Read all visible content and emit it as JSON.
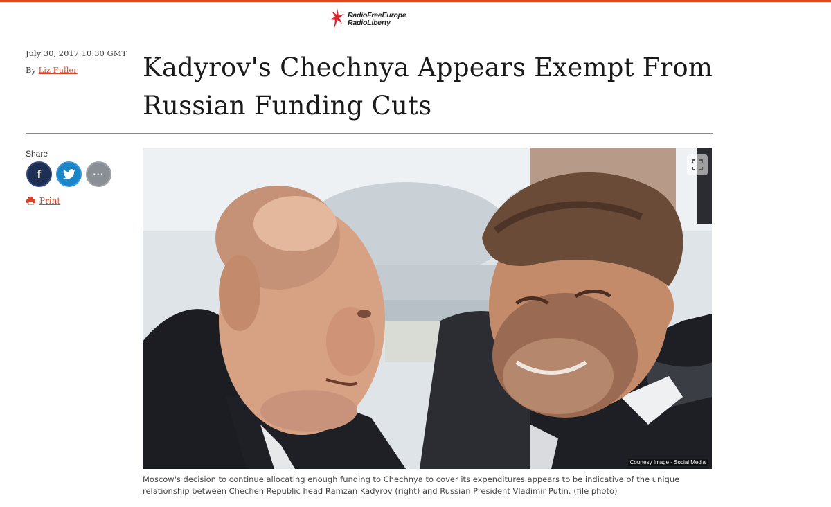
{
  "brand": {
    "line1": "RadioFreeEurope",
    "line2": "RadioLiberty",
    "accent_color": "#e0471f"
  },
  "article": {
    "date": "July 30, 2017 10:30 GMT",
    "by_prefix": "By",
    "author": "Liz Fuller",
    "title": "Kadyrov's Chechnya Appears Exempt From Russian Funding Cuts"
  },
  "share": {
    "label": "Share",
    "buttons": [
      {
        "icon": "facebook-icon",
        "glyph": "f",
        "color": "#1d2f52"
      },
      {
        "icon": "twitter-icon",
        "glyph": "twitter-bird",
        "color": "#1a86c8"
      },
      {
        "icon": "more-icon",
        "glyph": "...",
        "color": "#8a8f96"
      }
    ],
    "print_label": "Print"
  },
  "photo": {
    "credit": "Courtesy Image - Social Media",
    "expand_icon": "expand-icon",
    "caption": "Moscow's decision to continue allocating enough funding to Chechnya to cover its expenditures appears to be indicative of the unique relationship between Chechen Republic head Ramzan Kadyrov (right) and Russian President Vladimir Putin. (file photo)"
  }
}
